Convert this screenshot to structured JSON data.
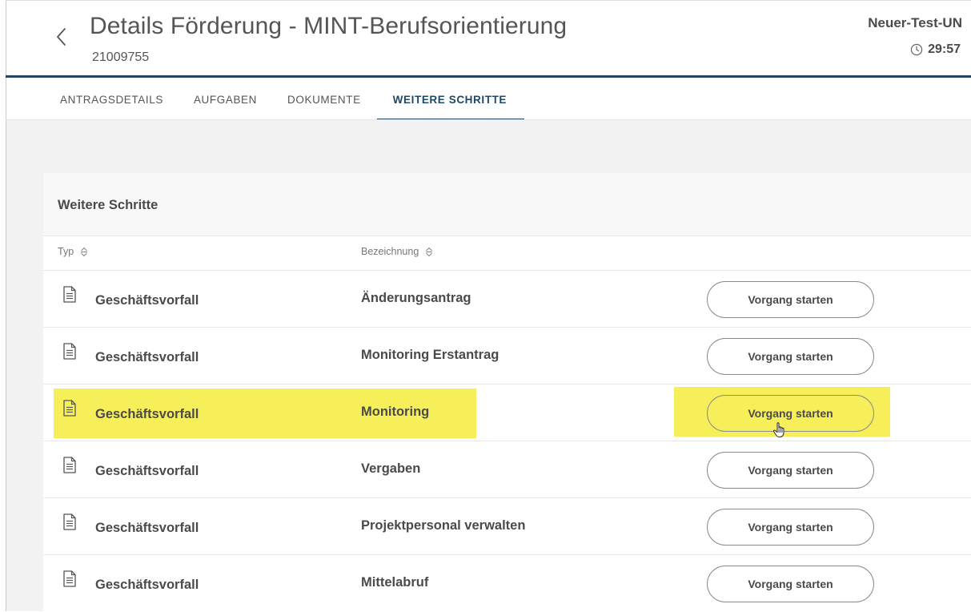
{
  "header": {
    "title": "Details Förderung - MINT-Berufsorientierung",
    "id": "21009755",
    "user": "Neuer-Test-UN",
    "timer": "29:57"
  },
  "tabs": [
    {
      "label": "ANTRAGSDETAILS",
      "active": false
    },
    {
      "label": "AUFGABEN",
      "active": false
    },
    {
      "label": "DOKUMENTE",
      "active": false
    },
    {
      "label": "WEITERE SCHRITTE",
      "active": true
    }
  ],
  "card": {
    "title": "Weitere Schritte",
    "columns": {
      "typ": "Typ",
      "bezeichnung": "Bezeichnung"
    },
    "rows": [
      {
        "type": "Geschäftsvorfall",
        "name": "Änderungsantrag",
        "button": "Vorgang starten"
      },
      {
        "type": "Geschäftsvorfall",
        "name": "Monitoring Erstantrag",
        "button": "Vorgang starten"
      },
      {
        "type": "Geschäftsvorfall",
        "name": "Monitoring",
        "button": "Vorgang starten",
        "highlighted": true
      },
      {
        "type": "Geschäftsvorfall",
        "name": "Vergaben",
        "button": "Vorgang starten"
      },
      {
        "type": "Geschäftsvorfall",
        "name": "Projektpersonal verwalten",
        "button": "Vorgang starten"
      },
      {
        "type": "Geschäftsvorfall",
        "name": "Mittelabruf",
        "button": "Vorgang starten"
      }
    ]
  },
  "colors": {
    "accent": "#21465f",
    "highlight": "#f7ef5a",
    "background": "#f2f2f2"
  },
  "icons": [
    "chevron-left-icon",
    "clock-icon",
    "sort-icon",
    "document-icon",
    "hand-cursor-icon"
  ]
}
